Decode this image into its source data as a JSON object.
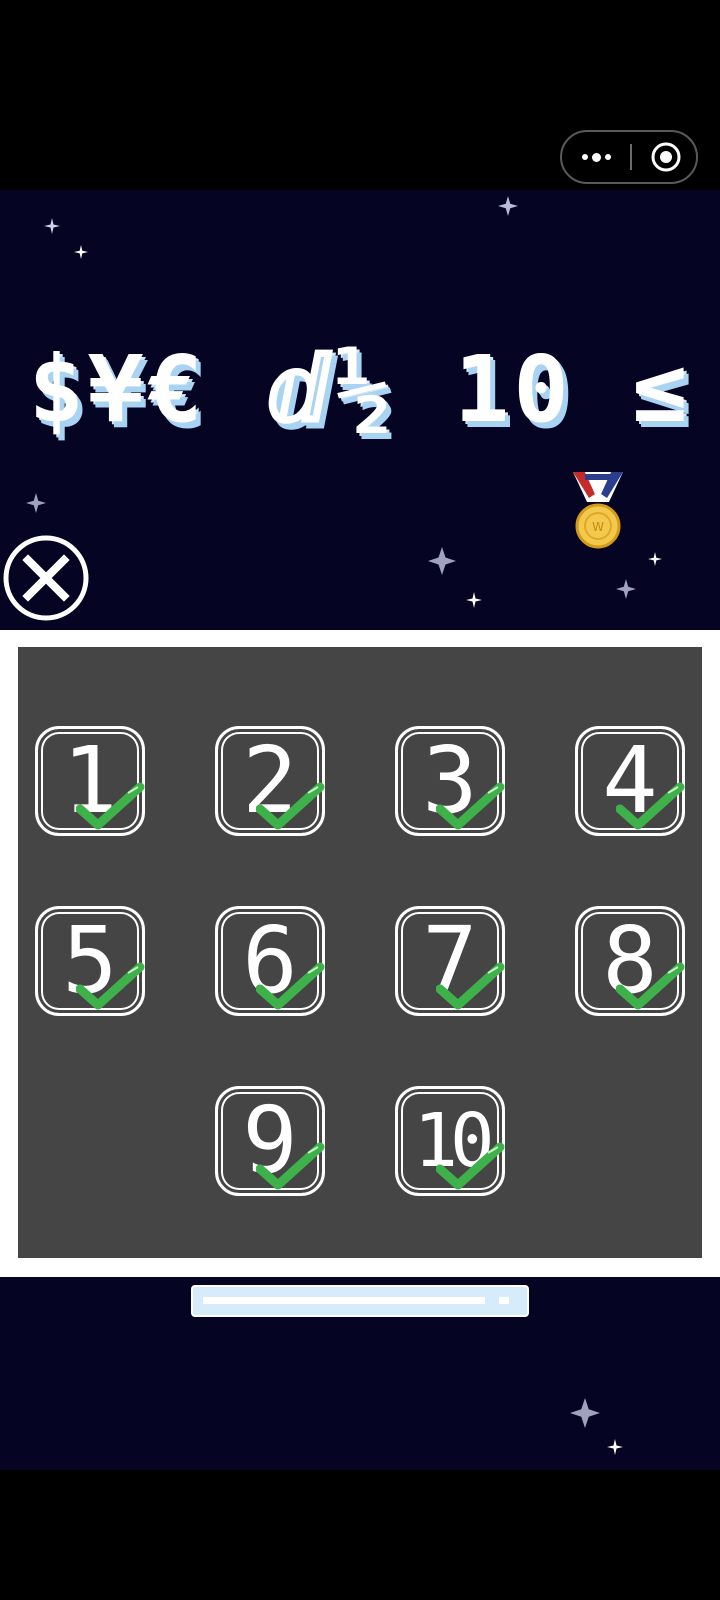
{
  "screen": {
    "title": "$¥€ ⅆ½ 10 ≤",
    "colors": {
      "space_background": "#050523",
      "panel_background": "#454545",
      "panel_frame": "#ffffff",
      "check_green": "#3fb14a",
      "title_shadow": "#a9d3f2"
    }
  },
  "top_capsule": {
    "more_icon": "more-dots-icon",
    "target_icon": "target-circle-icon"
  },
  "close_button": {
    "icon": "close-x-icon"
  },
  "medal": {
    "icon": "gold-medal-icon"
  },
  "levels": [
    {
      "label": "1",
      "completed": true
    },
    {
      "label": "2",
      "completed": true
    },
    {
      "label": "3",
      "completed": true
    },
    {
      "label": "4",
      "completed": true
    },
    {
      "label": "5",
      "completed": true
    },
    {
      "label": "6",
      "completed": true
    },
    {
      "label": "7",
      "completed": true
    },
    {
      "label": "8",
      "completed": true
    },
    {
      "label": "9",
      "completed": true
    },
    {
      "label": "10",
      "completed": true
    }
  ],
  "bottom_bar": {
    "icon": "light-bar-button"
  }
}
